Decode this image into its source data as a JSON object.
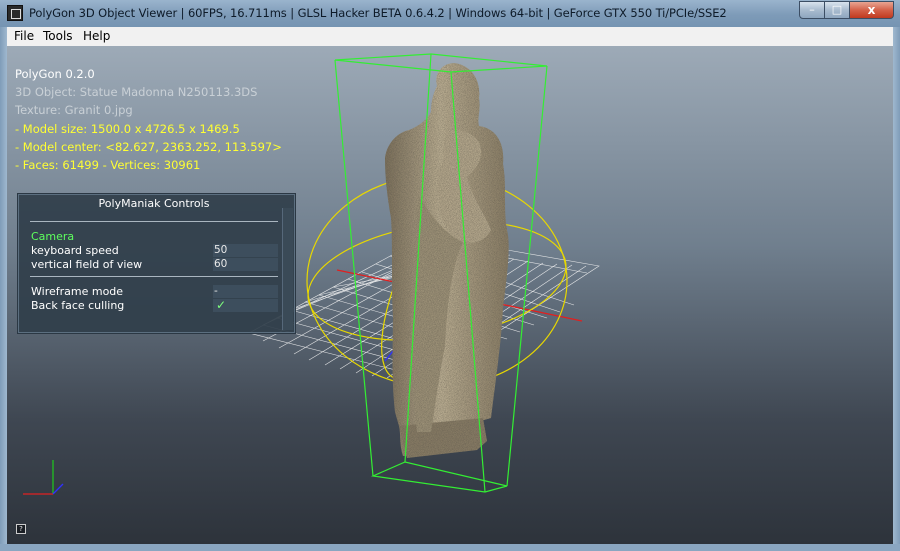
{
  "window": {
    "title": "PolyGon 3D Object Viewer | 60FPS, 16.711ms | GLSL Hacker BETA 0.6.4.2 | Windows 64-bit | GeForce GTX 550 Ti/PCIe/SSE2",
    "buttons": {
      "minimize": "–",
      "maximize": "□",
      "close": "x"
    }
  },
  "menu": {
    "items": [
      {
        "label": "File"
      },
      {
        "label": "Tools"
      },
      {
        "label": "Help"
      }
    ]
  },
  "info": {
    "app_version": "PolyGon 0.2.0",
    "object": "3D Object: Statue Madonna N250113.3DS",
    "texture": "Texture: Granit 0.jpg",
    "model_size": "- Model size:  1500.0 x 4726.5 x 1469.5",
    "model_center": "- Model center:  <82.627, 2363.252, 113.597>",
    "faces_vertices": "- Faces: 61499 - Vertices: 30961"
  },
  "panel": {
    "title": "PolyManiak Controls",
    "section_camera": "Camera",
    "keyboard_speed_label": "keyboard speed",
    "keyboard_speed_value": "50",
    "fov_label": "vertical field of view",
    "fov_value": "60",
    "wireframe_label": "Wireframe mode",
    "wireframe_value": "-",
    "backface_label": "Back face culling",
    "backface_value": "✓"
  },
  "colors": {
    "bounding_box": "#33ee33",
    "gizmo": "#e8d800",
    "grid": "#f5f5f5",
    "axis_x": "#e02020",
    "axis_y": "#20c020",
    "axis_z": "#3030ff",
    "statue": "#a89a7e"
  },
  "icons": {
    "app": "polygon-app-icon",
    "help": "help-icon"
  },
  "help_icon_glyph": "?"
}
